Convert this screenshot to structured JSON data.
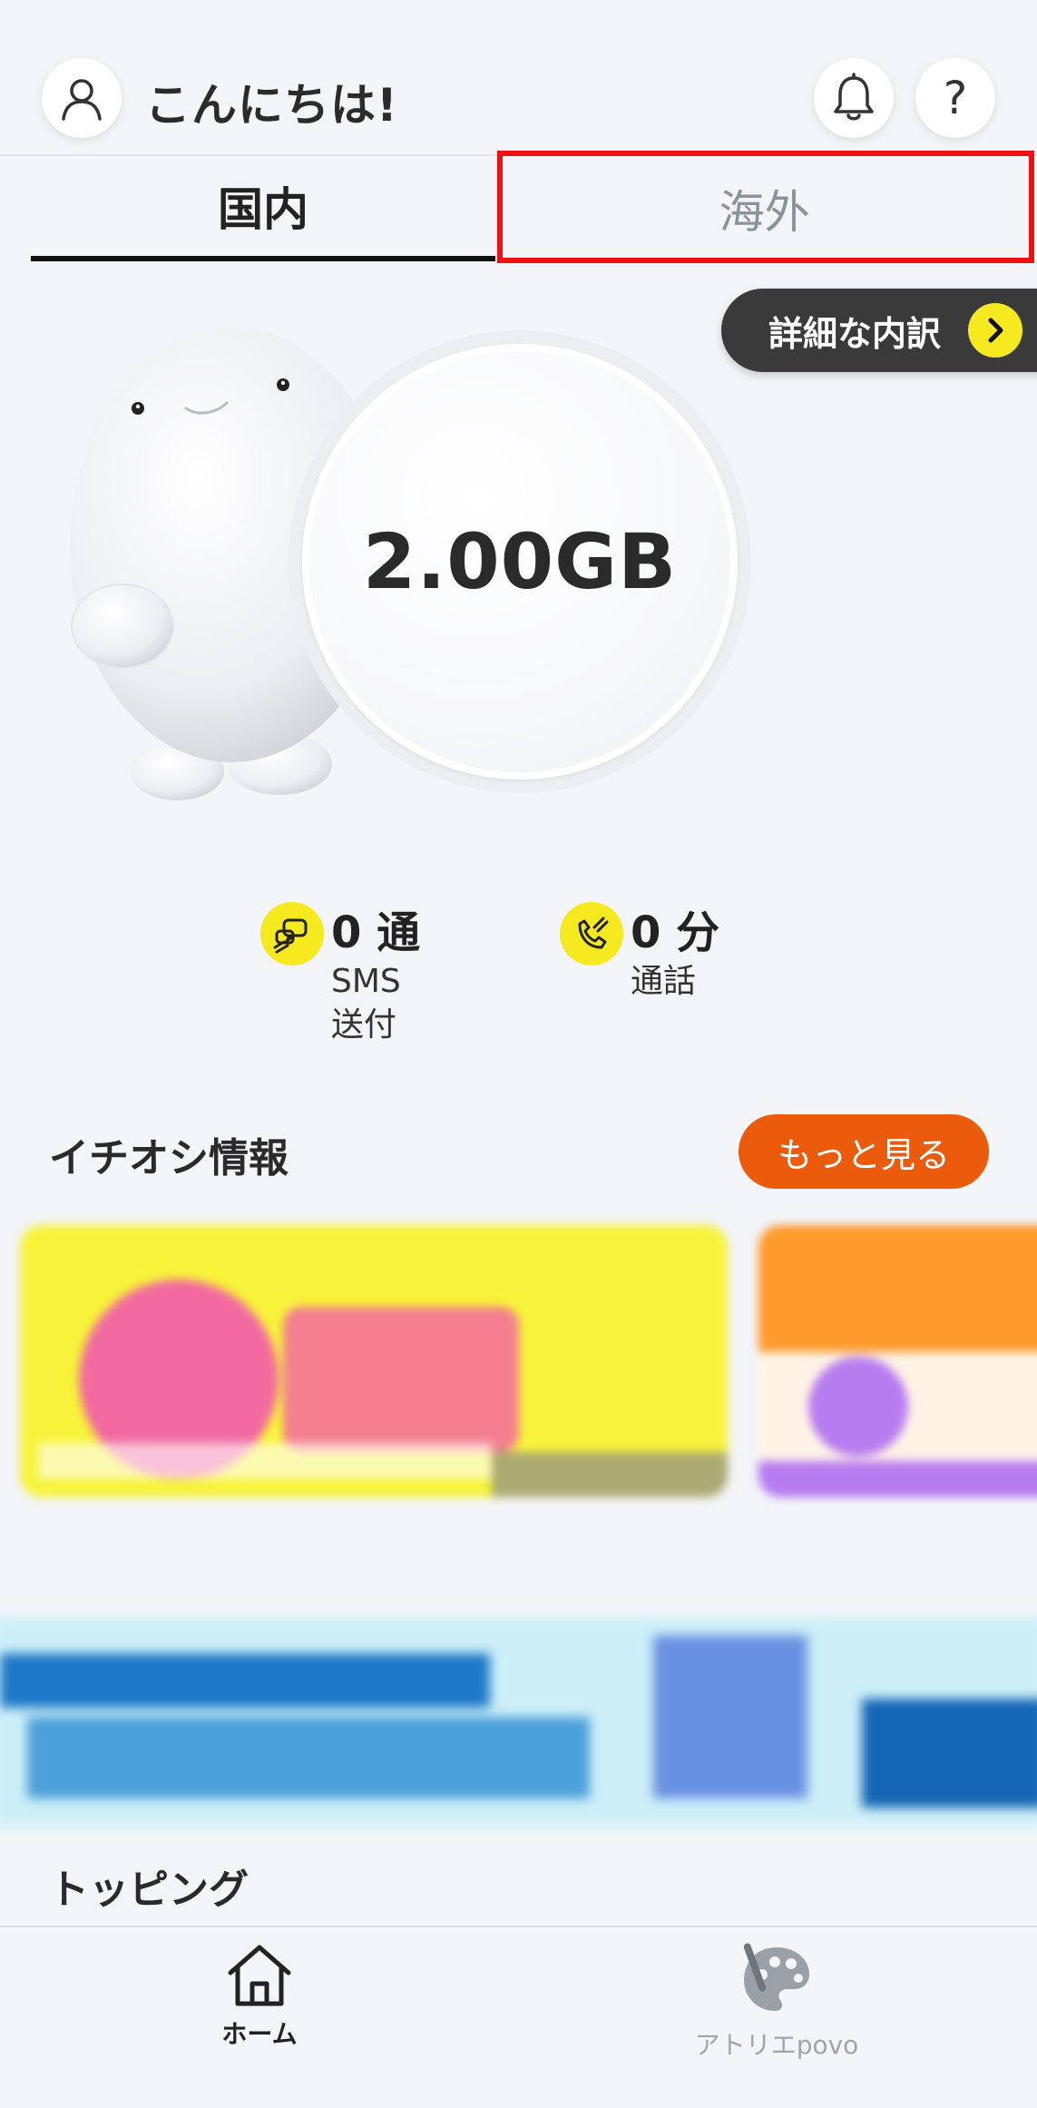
{
  "header": {
    "greeting": "こんにちは!",
    "avatar_icon": "user-outline-icon",
    "bell_icon": "bell-icon",
    "help_label": "?"
  },
  "tabs": [
    {
      "label": "国内",
      "selected": true
    },
    {
      "label": "海外",
      "selected": false,
      "highlighted": true
    }
  ],
  "detail": {
    "label": "詳細な内訳",
    "icon": "chevron-right-icon"
  },
  "data_usage": {
    "amount": "2.00GB"
  },
  "stats": {
    "sms": {
      "value": "0 通",
      "label_line1": "SMS",
      "label_line2": "送付",
      "icon": "chat-bubble-icon"
    },
    "call": {
      "value": "0 分",
      "label": "通話",
      "icon": "phone-icon"
    }
  },
  "recommended": {
    "title": "イチオシ情報",
    "more_label": "もっと見る"
  },
  "topping": {
    "title": "トッピング"
  },
  "bottom_nav": [
    {
      "label": "ホーム",
      "icon": "home-icon",
      "active": true
    },
    {
      "label": "アトリエpovo",
      "icon": "palette-icon",
      "active": false
    }
  ],
  "colors": {
    "accent_yellow": "#f7e920",
    "accent_orange": "#ec5a0c",
    "highlight_red": "#ee1111",
    "background": "#f3f5f9"
  }
}
